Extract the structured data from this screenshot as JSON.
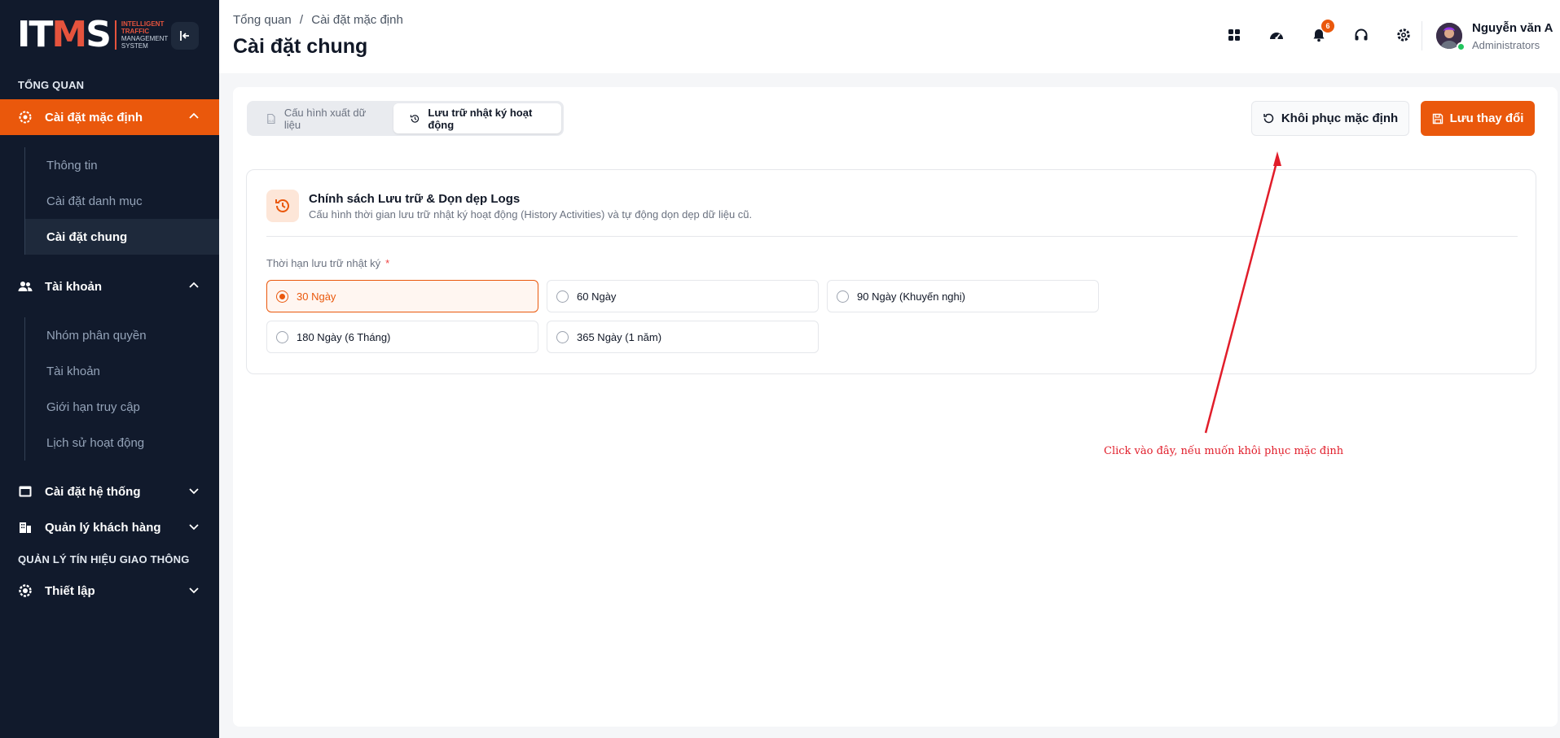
{
  "sidebar": {
    "logo_mark_white_1": "IT",
    "logo_mark_red": "M",
    "logo_mark_white_2": "S",
    "logo_line1": "INTELLIGENT",
    "logo_line2": "TRAFFIC",
    "logo_line3": "MANAGEMENT",
    "logo_line4": "SYSTEM",
    "section_overview": "TỔNG QUAN",
    "default_settings": "Cài đặt mặc định",
    "default_sub": [
      "Thông tin",
      "Cài đặt danh mục",
      "Cài đặt chung"
    ],
    "account": "Tài khoản",
    "account_sub": [
      "Nhóm phân quyền",
      "Tài khoản",
      "Giới hạn truy cập",
      "Lịch sử hoạt động"
    ],
    "system_settings": "Cài đặt hệ thống",
    "customer_mgmt": "Quản lý khách hàng",
    "section_signal": "QUẢN LÝ TÍN HIỆU GIAO THÔNG",
    "setup": "Thiết lập"
  },
  "header": {
    "breadcrumb_root": "Tổng quan",
    "breadcrumb_sep": "/",
    "breadcrumb_current": "Cài đặt mặc định",
    "title": "Cài đặt chung",
    "notification_count": "6",
    "user_name": "Nguyễn văn A",
    "user_role": "Administrators"
  },
  "main": {
    "tab_export": "Cấu hình xuất dữ liệu",
    "tab_logs": "Lưu trữ nhật ký hoạt động",
    "restore_label": "Khôi phục mặc định",
    "save_label": "Lưu thay đổi",
    "card_title": "Chính sách Lưu trữ & Dọn dẹp Logs",
    "card_desc": "Cấu hình thời gian lưu trữ nhật ký hoạt động (History Activities) và tự động dọn dẹp dữ liệu cũ.",
    "field_label": "Thời hạn lưu trữ nhật ký",
    "required_mark": "*",
    "options": [
      "30 Ngày",
      "60 Ngày",
      "90 Ngày (Khuyến nghị)",
      "180 Ngày (6 Tháng)",
      "365 Ngày (1 năm)"
    ],
    "selected_option": "30 Ngày"
  },
  "annotation": {
    "text": "Click vào đây, nếu muốn khôi phục mặc định"
  },
  "colors": {
    "accent": "#ea580c",
    "sidebar_bg": "#111a2c",
    "annotation": "#e11d2a"
  }
}
